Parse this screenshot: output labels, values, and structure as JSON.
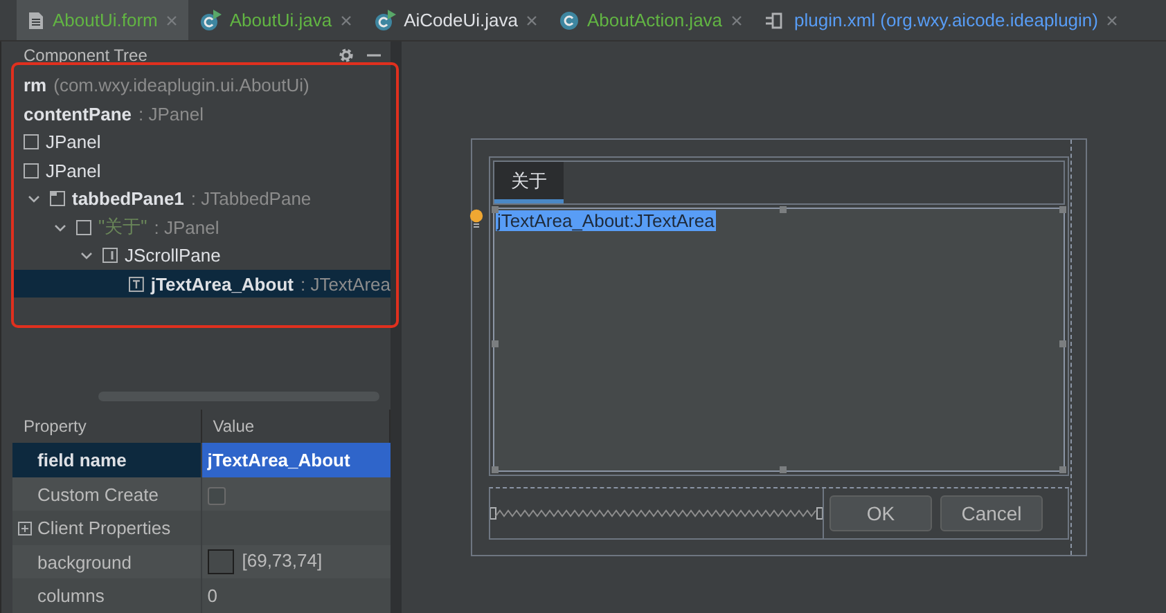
{
  "editor_tabs": [
    {
      "label": "AboutUi.form",
      "kind": "form",
      "color": "#62b543",
      "selected": true
    },
    {
      "label": "AboutUi.java",
      "kind": "runnable",
      "color": "#62b543",
      "selected": false
    },
    {
      "label": "AiCodeUi.java",
      "kind": "runnable",
      "color": "#dfe1e5",
      "selected": false
    },
    {
      "label": "AboutAction.java",
      "kind": "class",
      "color": "#62b543",
      "selected": false
    },
    {
      "label": "plugin.xml (org.wxy.aicode.ideaplugin)",
      "kind": "plugin",
      "color": "#589df6",
      "selected": false
    }
  ],
  "component_tree": {
    "title": "Component Tree",
    "nodes": [
      {
        "name": "rm",
        "kind": "form",
        "bound": true,
        "type": "(com.wxy.ideaplugin.ui.AboutUi)",
        "selected": false
      },
      {
        "name": "contentPane",
        "kind": "root",
        "bound": true,
        "type": ": JPanel",
        "selected": false
      },
      {
        "name": "JPanel",
        "kind": "panel",
        "bound": false,
        "selected": false
      },
      {
        "name": "JPanel",
        "kind": "panel",
        "bound": false,
        "selected": false
      },
      {
        "name": "tabbedPane1",
        "kind": "tabbed",
        "bound": true,
        "type": ": JTabbedPane",
        "expanded": true,
        "selected": false,
        "children": [
          {
            "name": "\"关于\"",
            "kind": "tab-panel",
            "bound": false,
            "type": ": JPanel",
            "expanded": true,
            "selected": false,
            "children": [
              {
                "name": "JScrollPane",
                "kind": "scroll",
                "bound": false,
                "expanded": true,
                "selected": false,
                "children": [
                  {
                    "name": "jTextArea_About",
                    "kind": "text",
                    "bound": true,
                    "type": ": JTextArea",
                    "selected": true
                  }
                ]
              }
            ]
          }
        ]
      }
    ]
  },
  "properties": {
    "columns": [
      "Property",
      "Value"
    ],
    "rows": [
      {
        "kind": "text",
        "name": "field name",
        "value": "jTextArea_About",
        "modified": true,
        "selected": true
      },
      {
        "kind": "checkbox",
        "name": "Custom Create",
        "checked": false,
        "modified": false,
        "selected": false
      },
      {
        "kind": "group",
        "name": "Client Properties",
        "expanded": false,
        "modified": false,
        "selected": false
      },
      {
        "kind": "color",
        "name": "background",
        "value": "[69,73,74]",
        "color": "#45494a",
        "modified": false,
        "selected": false
      },
      {
        "kind": "text",
        "name": "columns",
        "value": "0",
        "modified": false,
        "selected": false
      }
    ]
  },
  "form": {
    "tabs": [
      {
        "label": "关于",
        "selected": true
      }
    ],
    "text_area": {
      "label": "jTextArea_About:JTextArea",
      "selected": true
    },
    "buttons": [
      "OK",
      "Cancel"
    ]
  }
}
